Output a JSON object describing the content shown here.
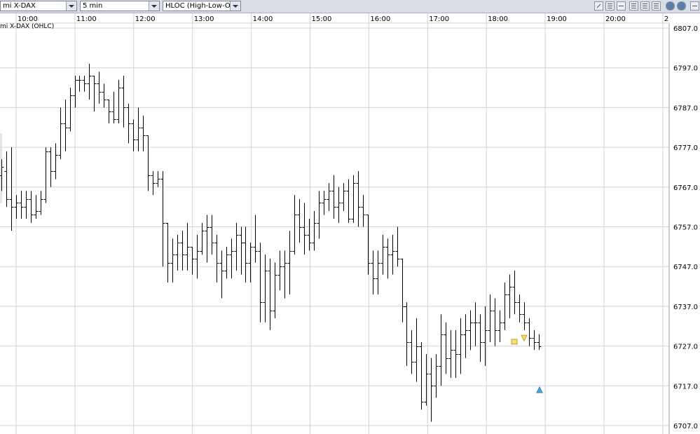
{
  "toolbar": {
    "instrument": "mi X-DAX",
    "interval": "5 min",
    "chart_style": "HLOC (High-Low-Op",
    "icons": [
      "pencil-icon",
      "list-icon",
      "eraser-icon",
      "grid-icon",
      "grid-icon",
      "grid-icon",
      "circle-icon",
      "gear-icon",
      "window-icon"
    ]
  },
  "chart_data": {
    "type": "ohlc",
    "title": "mi X-DAX (OHLC)",
    "x_ticks": [
      "10:00",
      "11:00",
      "12:00",
      "13:00",
      "14:00",
      "15:00",
      "16:00",
      "17:00",
      "18:00",
      "19:00",
      "20:00",
      "2"
    ],
    "y_ticks": [
      "6807.0",
      "6797.0",
      "6787.0",
      "6777.0",
      "6767.0",
      "6757.0",
      "6747.0",
      "6737.0",
      "6727.0",
      "6717.0",
      "6707.0"
    ],
    "ylim": [
      6707,
      6807
    ],
    "time_start": "09:50",
    "time_step_minutes": 5,
    "grid": true,
    "colors": {
      "bar": "#000000",
      "grid": "#cfd3d9",
      "buy": "#49a8e0",
      "sell": "#f0e070"
    },
    "bars": [
      [
        6772,
        6775,
        6767,
        6769
      ],
      [
        6770,
        6774,
        6766,
        6772
      ],
      [
        6771,
        6776,
        6762,
        6764
      ],
      [
        6764,
        6777,
        6756,
        6762
      ],
      [
        6762,
        6765,
        6759,
        6763
      ],
      [
        6763,
        6766,
        6759,
        6762
      ],
      [
        6762,
        6766,
        6759,
        6764
      ],
      [
        6764,
        6766,
        6758,
        6760
      ],
      [
        6760,
        6765,
        6759,
        6761
      ],
      [
        6761,
        6766,
        6760,
        6764
      ],
      [
        6764,
        6777,
        6763,
        6776
      ],
      [
        6776,
        6777,
        6767,
        6771
      ],
      [
        6771,
        6778,
        6769,
        6775
      ],
      [
        6775,
        6787,
        6774,
        6783
      ],
      [
        6783,
        6789,
        6776,
        6782
      ],
      [
        6782,
        6792,
        6781,
        6790
      ],
      [
        6790,
        6795,
        6787,
        6794
      ],
      [
        6794,
        6795,
        6791,
        6794
      ],
      [
        6794,
        6795,
        6791,
        6793
      ],
      [
        6793,
        6798,
        6789,
        6795
      ],
      [
        6795,
        6795,
        6786,
        6793
      ],
      [
        6793,
        6796,
        6788,
        6791
      ],
      [
        6791,
        6793,
        6787,
        6789
      ],
      [
        6789,
        6789,
        6783,
        6786
      ],
      [
        6786,
        6791,
        6783,
        6784
      ],
      [
        6784,
        6794,
        6783,
        6792
      ],
      [
        6792,
        6795,
        6782,
        6787
      ],
      [
        6787,
        6788,
        6778,
        6783
      ],
      [
        6783,
        6784,
        6776,
        6779
      ],
      [
        6779,
        6787,
        6776,
        6782
      ],
      [
        6782,
        6785,
        6776,
        6780
      ],
      [
        6780,
        6780,
        6766,
        6770
      ],
      [
        6770,
        6771,
        6765,
        6768
      ],
      [
        6768,
        6771,
        6767,
        6769
      ],
      [
        6769,
        6771,
        6747,
        6758
      ],
      [
        6758,
        6758,
        6743,
        6748
      ],
      [
        6748,
        6754,
        6743,
        6750
      ],
      [
        6750,
        6755,
        6746,
        6753
      ],
      [
        6753,
        6756,
        6746,
        6750
      ],
      [
        6750,
        6758,
        6746,
        6752
      ],
      [
        6752,
        6752,
        6745,
        6749
      ],
      [
        6749,
        6755,
        6744,
        6751
      ],
      [
        6751,
        6758,
        6750,
        6756
      ],
      [
        6756,
        6760,
        6748,
        6757
      ],
      [
        6757,
        6760,
        6750,
        6753
      ],
      [
        6753,
        6755,
        6743,
        6748
      ],
      [
        6748,
        6751,
        6739,
        6746
      ],
      [
        6746,
        6752,
        6744,
        6750
      ],
      [
        6750,
        6754,
        6744,
        6751
      ],
      [
        6751,
        6758,
        6746,
        6755
      ],
      [
        6755,
        6757,
        6745,
        6753
      ],
      [
        6753,
        6757,
        6743,
        6748
      ],
      [
        6748,
        6753,
        6743,
        6752
      ],
      [
        6752,
        6760,
        6748,
        6751
      ],
      [
        6751,
        6753,
        6733,
        6738
      ],
      [
        6738,
        6750,
        6733,
        6746
      ],
      [
        6746,
        6749,
        6731,
        6736
      ],
      [
        6736,
        6748,
        6734,
        6745
      ],
      [
        6745,
        6751,
        6741,
        6747
      ],
      [
        6747,
        6751,
        6739,
        6748
      ],
      [
        6748,
        6756,
        6740,
        6751
      ],
      [
        6751,
        6765,
        6750,
        6760
      ],
      [
        6760,
        6764,
        6753,
        6757
      ],
      [
        6757,
        6763,
        6750,
        6755
      ],
      [
        6755,
        6759,
        6751,
        6753
      ],
      [
        6753,
        6761,
        6751,
        6758
      ],
      [
        6758,
        6766,
        6754,
        6763
      ],
      [
        6763,
        6766,
        6760,
        6764
      ],
      [
        6764,
        6768,
        6761,
        6766
      ],
      [
        6766,
        6770,
        6759,
        6762
      ],
      [
        6762,
        6767,
        6758,
        6763
      ],
      [
        6763,
        6768,
        6761,
        6766
      ],
      [
        6766,
        6769,
        6758,
        6759
      ],
      [
        6759,
        6770,
        6758,
        6768
      ],
      [
        6768,
        6771,
        6757,
        6762
      ],
      [
        6762,
        6765,
        6757,
        6760
      ],
      [
        6760,
        6760,
        6745,
        6748
      ],
      [
        6748,
        6751,
        6740,
        6744
      ],
      [
        6744,
        6751,
        6740,
        6748
      ],
      [
        6748,
        6755,
        6745,
        6752
      ],
      [
        6752,
        6754,
        6744,
        6750
      ],
      [
        6750,
        6755,
        6745,
        6751
      ],
      [
        6751,
        6757,
        6747,
        6749
      ],
      [
        6749,
        6749,
        6733,
        6737
      ],
      [
        6737,
        6738,
        6722,
        6728
      ],
      [
        6728,
        6731,
        6720,
        6723
      ],
      [
        6723,
        6734,
        6718,
        6727
      ],
      [
        6727,
        6728,
        6711,
        6713
      ],
      [
        6713,
        6725,
        6712,
        6720
      ],
      [
        6720,
        6724,
        6708,
        6717
      ],
      [
        6717,
        6725,
        6714,
        6722
      ],
      [
        6722,
        6735,
        6717,
        6730
      ],
      [
        6730,
        6733,
        6720,
        6724
      ],
      [
        6724,
        6731,
        6719,
        6726
      ],
      [
        6726,
        6731,
        6719,
        6725
      ],
      [
        6725,
        6734,
        6720,
        6730
      ],
      [
        6730,
        6735,
        6724,
        6731
      ],
      [
        6731,
        6736,
        6726,
        6733
      ],
      [
        6733,
        6738,
        6727,
        6733
      ],
      [
        6733,
        6735,
        6723,
        6728
      ],
      [
        6728,
        6737,
        6722,
        6731
      ],
      [
        6731,
        6740,
        6728,
        6736
      ],
      [
        6736,
        6739,
        6727,
        6731
      ],
      [
        6731,
        6736,
        6728,
        6733
      ],
      [
        6733,
        6743,
        6731,
        6740
      ],
      [
        6740,
        6745,
        6734,
        6742
      ],
      [
        6742,
        6746,
        6735,
        6738
      ],
      [
        6738,
        6740,
        6733,
        6735
      ],
      [
        6735,
        6738,
        6731,
        6733
      ],
      [
        6733,
        6734,
        6727,
        6729
      ],
      [
        6729,
        6731,
        6726,
        6728
      ],
      [
        6728,
        6730,
        6726,
        6727
      ]
    ]
  }
}
